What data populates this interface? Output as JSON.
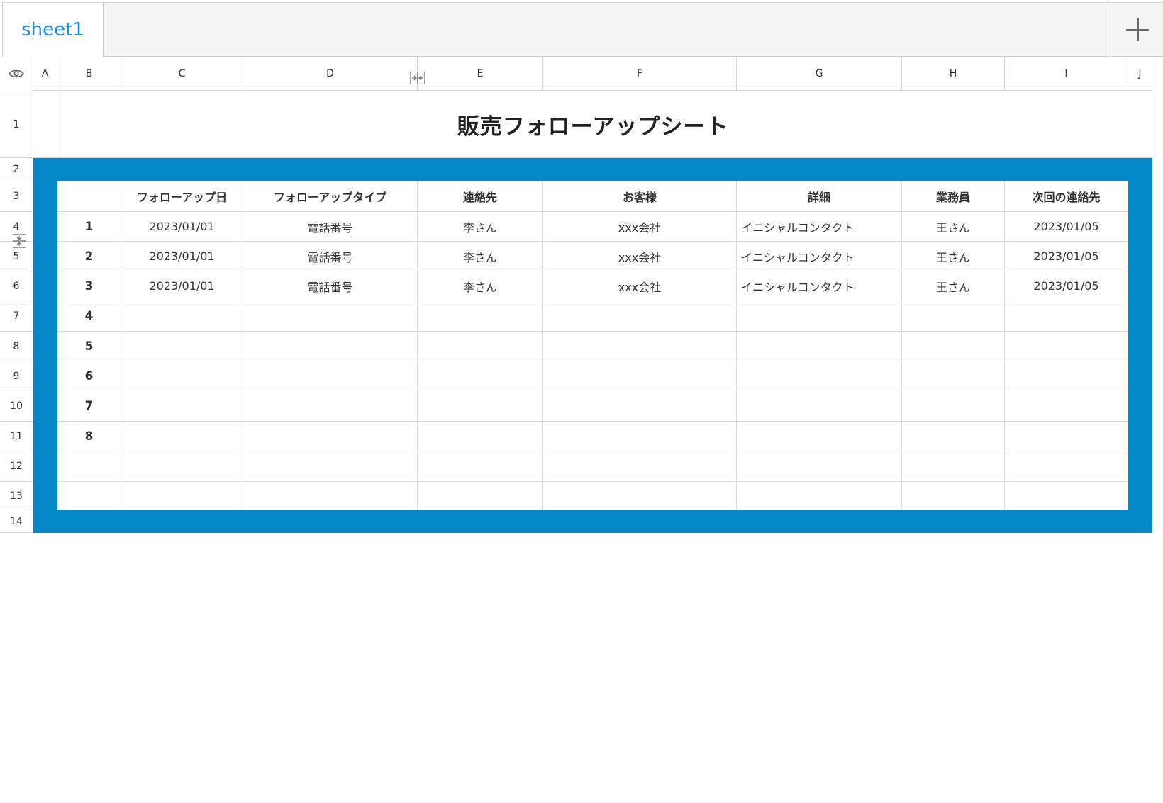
{
  "tabs": {
    "active": "sheet1",
    "add_icon": "plus-icon"
  },
  "header": {
    "corner_icon": "eye-icon",
    "columns": [
      "A",
      "B",
      "C",
      "D",
      "E",
      "F",
      "G",
      "H",
      "I",
      "J"
    ]
  },
  "rows": [
    "1",
    "2",
    "3",
    "4",
    "5",
    "6",
    "7",
    "8",
    "9",
    "10",
    "11",
    "12",
    "13",
    "14"
  ],
  "sheet": {
    "title": "販売フォローアップシート",
    "headers": [
      "フォローアップ日",
      "フォローアップタイプ",
      "連絡先",
      "お客様",
      "詳細",
      "業務員",
      "次回の連絡先"
    ],
    "index": [
      "1",
      "2",
      "3",
      "4",
      "5",
      "6",
      "7",
      "8"
    ],
    "records": [
      [
        "2023/01/01",
        "電話番号",
        "李さん",
        "xxx会社",
        "イニシャルコンタクト",
        "王さん",
        "2023/01/05"
      ],
      [
        "2023/01/01",
        "電話番号",
        "李さん",
        "xxx会社",
        "イニシャルコンタクト",
        "王さん",
        "2023/01/05"
      ],
      [
        "2023/01/01",
        "電話番号",
        "李さん",
        "xxx会社",
        "イニシャルコンタクト",
        "王さん",
        "2023/01/05"
      ]
    ]
  },
  "colors": {
    "band": "#0288c6",
    "tab_active": "#1a8fe3"
  }
}
